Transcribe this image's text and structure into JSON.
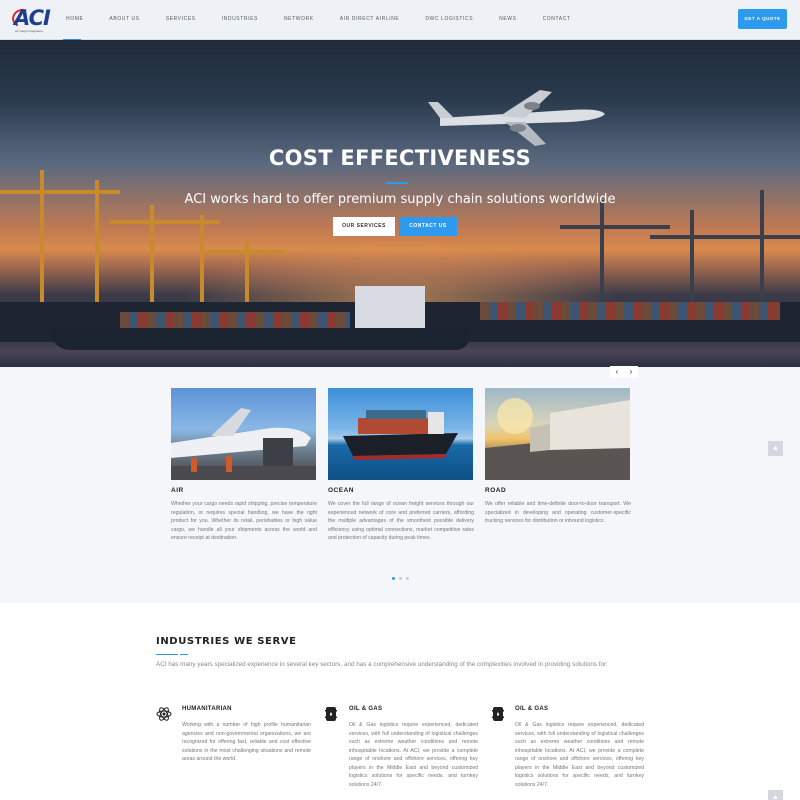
{
  "header": {
    "logo_text": "ACI",
    "logo_tagline": "Air Cargo Integrators",
    "nav": [
      "HOME",
      "ABOUT US",
      "SERVICES",
      "INDUSTRIES",
      "NETWORK",
      "AIR DIRECT AIRLINE",
      "DWC LOGISTICS",
      "NEWS",
      "CONTACT"
    ],
    "quote_button": "GET A QUOTE"
  },
  "hero": {
    "title": "COST EFFECTIVENESS",
    "subtitle": "ACI works hard to offer premium supply chain solutions worldwide",
    "services_button": "OUR SERVICES",
    "contact_button": "CONTACT US",
    "prev_icon": "‹",
    "next_icon": "›"
  },
  "services": [
    {
      "title": "AIR",
      "text": "Whether your cargo needs rapid shipping, precise temperature regulation, or requires special handling, we have the right product for you. Whether its retail, perishables or high value cargo, we handle all your shipments across the world and ensure receipt at destination."
    },
    {
      "title": "OCEAN",
      "text": "We cover the full range of ocean freight services through our experienced network of core and preferred carriers, affording the multiple advantages of the smoothest possible delivery efficiency using optimal connections, market competitive rates and protection of capacity during peak times."
    },
    {
      "title": "ROAD",
      "text": "We offer reliable and time-definite door-to-door transport. We specialized in developing and operating customer-specific trucking services for distribution or inbound logistics."
    }
  ],
  "industries": {
    "heading": "INDUSTRIES WE SERVE",
    "intro": "ACI has many years specialized experience in several key sectors, and has a comprehensive understanding of the complexities involved in providing solutions for:",
    "items": [
      {
        "title": "HUMANITARIAN",
        "icon": "atom-icon",
        "text": "Working with a number of high profile humanitarian agencies and non-governmental organizations, we are recognized for offering fast, reliable and cost effective solutions in the most challenging situations and remote areas around the world."
      },
      {
        "title": "OIL & GAS",
        "icon": "oil-barrel-icon",
        "text": "Oil & Gas logistics require experienced, dedicated services, with full understanding of logistical challenges such as extreme weather conditions and remote inhospitable locations. At ACI, we provide a complete range of onshore and offshore services, offering key players in the Middle East and beyond customized logistics solutions for specific needs, and turnkey solutions 24/7."
      },
      {
        "title": "OIL & GAS",
        "icon": "oil-barrel-icon",
        "text": "Oil & Gas logistics require experienced, dedicated services, with full understanding of logistical challenges such as extreme weather conditions and remote inhospitable locations. At ACI, we provide a complete range of onshore and offshore services, offering key players in the Middle East and beyond customized logistics solutions for specific needs, and turnkey solutions 24/7."
      }
    ]
  },
  "ui": {
    "scroll_top_icon": "▲"
  },
  "colors": {
    "accent": "#2d9af0",
    "brand_blue": "#1e3d8f",
    "brand_red": "#d7262b"
  }
}
